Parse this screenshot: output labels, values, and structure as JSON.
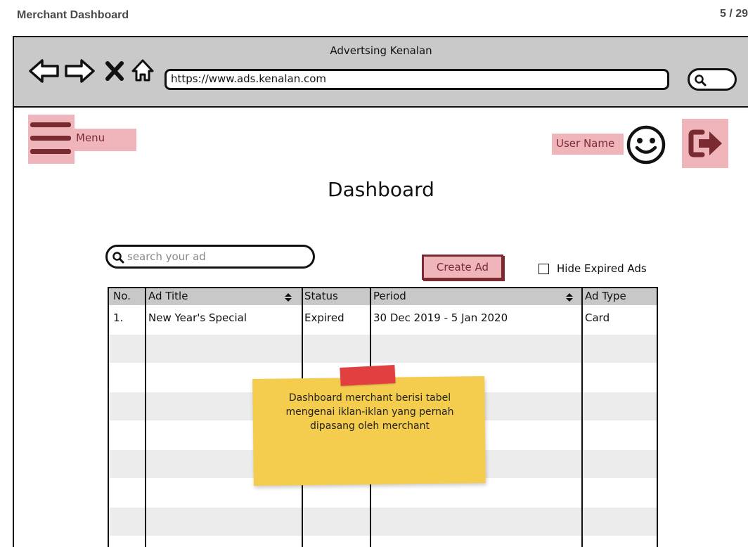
{
  "page": {
    "title": "Merchant Dashboard",
    "counter": "5 / 29"
  },
  "browser": {
    "title": "Advertsing Kenalan",
    "url": "https://www.ads.kenalan.com",
    "icons": [
      "back-arrow-icon",
      "forward-arrow-icon",
      "close-icon",
      "home-icon",
      "search-icon"
    ]
  },
  "header": {
    "menu_label": "Menu",
    "user_name": "User Name",
    "icons": [
      "hamburger-menu-icon",
      "smiley-avatar-icon",
      "logout-icon"
    ]
  },
  "dashboard": {
    "title": "Dashboard",
    "search_placeholder": "search your ad",
    "create_label": "Create Ad",
    "hide_expired_label": "Hide Expired Ads",
    "hide_expired_checked": false
  },
  "table": {
    "columns": [
      "No.",
      "Ad Title",
      "Status",
      "Period",
      "Ad Type"
    ],
    "sortable": [
      "Ad Title",
      "Period"
    ],
    "rows": [
      {
        "no": "1.",
        "title": "New Year's Special",
        "status": "Expired",
        "period": "30 Dec 2019 - 5 Jan 2020",
        "type": "Card"
      }
    ]
  },
  "note": {
    "lines": [
      "Dashboard merchant berisi tabel",
      "mengenai iklan-iklan yang pernah",
      "dipasang oleh merchant"
    ]
  },
  "colors": {
    "highlight": "#f0b4bb",
    "accent_dark": "#7a2b31",
    "browser_bar": "#c9c9c9",
    "sticky_note": "#f5cd4e",
    "tape": "#e24040"
  }
}
